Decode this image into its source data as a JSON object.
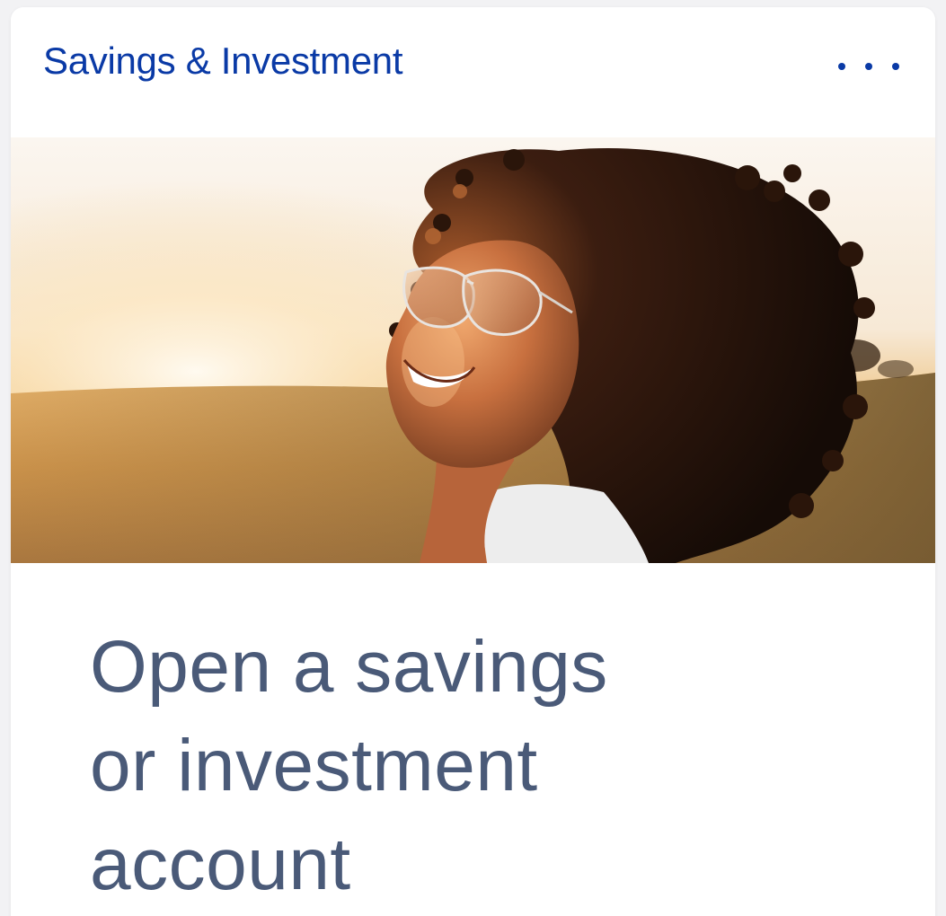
{
  "card": {
    "title": "Savings & Investment",
    "more_icon": "ellipsis-horizontal-icon",
    "hero_image": "smiling-woman-sunglasses-sunset-field",
    "promo_lines": [
      "Open a savings",
      "or investment",
      "account"
    ]
  },
  "colors": {
    "title": "#0a3aa6",
    "promo_text": "#4a5a78",
    "card_bg": "#ffffff",
    "page_bg": "#f2f2f4"
  }
}
